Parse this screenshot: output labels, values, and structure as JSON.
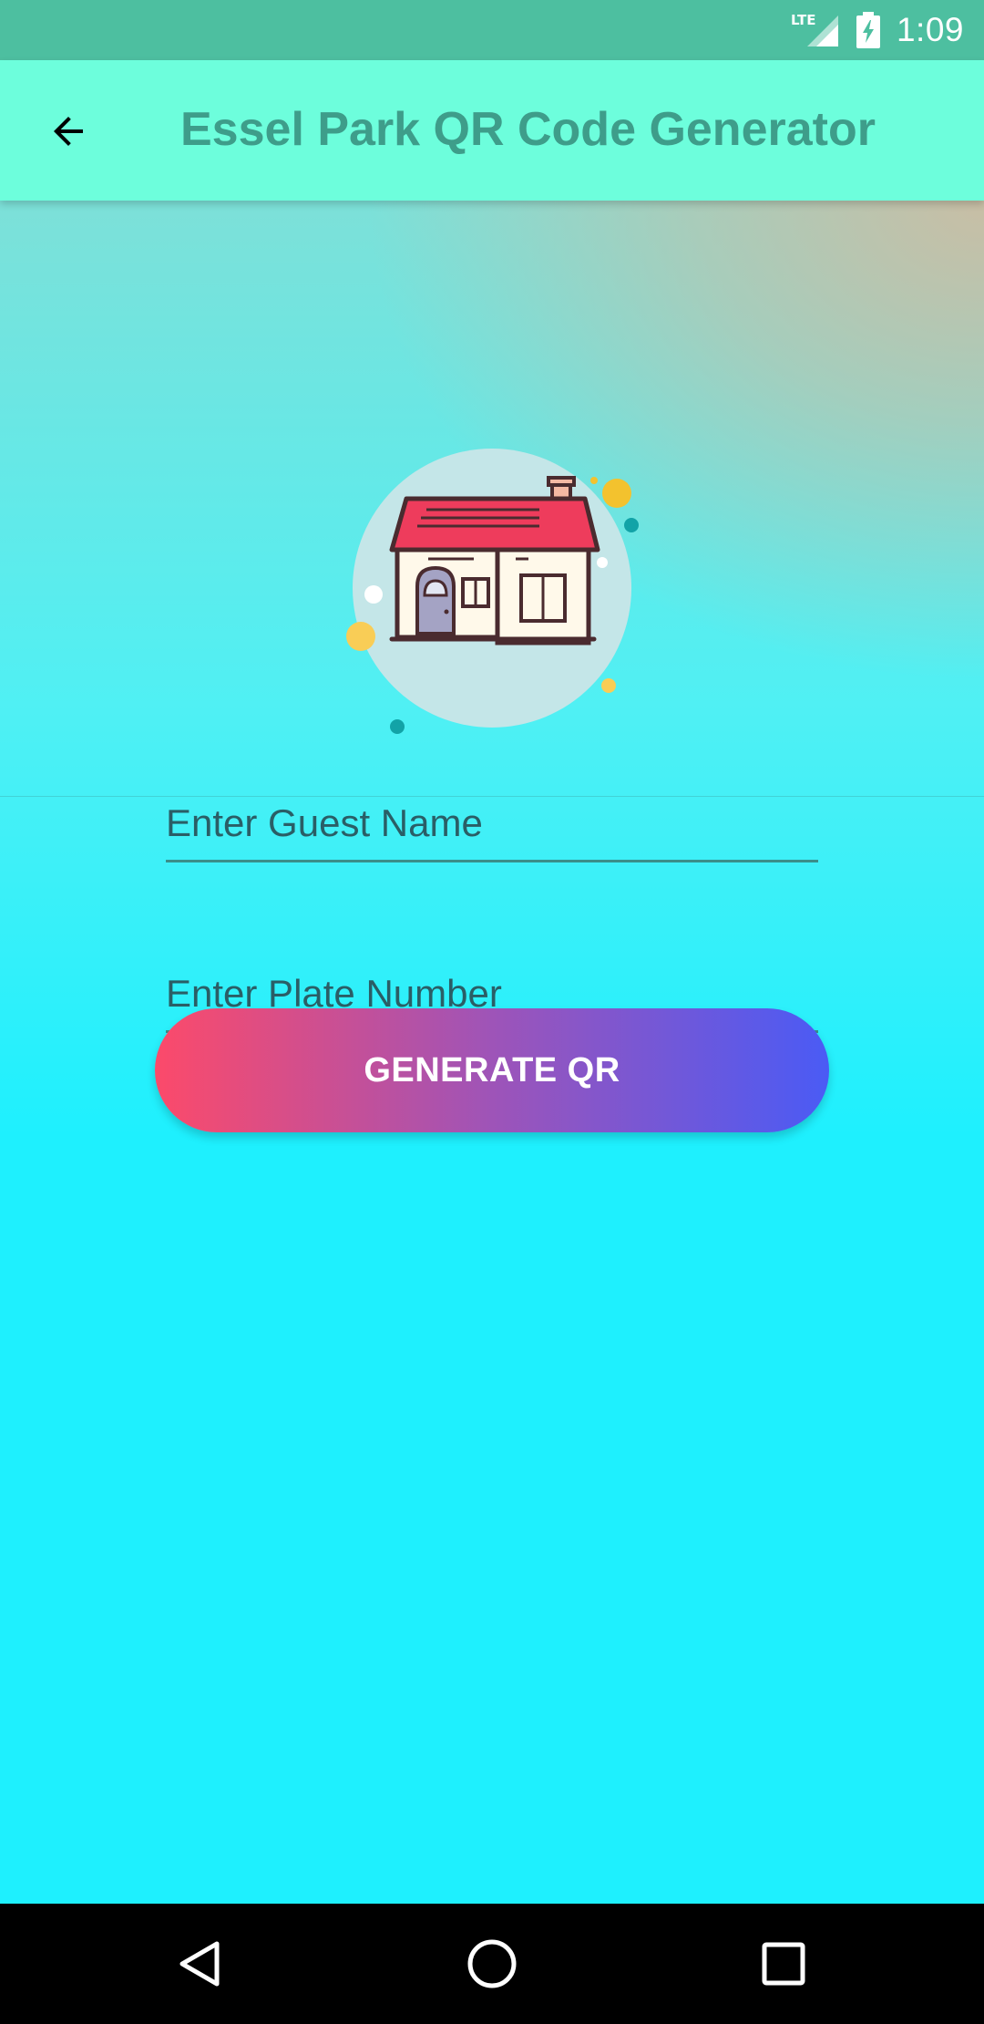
{
  "status_bar": {
    "network": "LTE",
    "time": "1:09"
  },
  "app_bar": {
    "title": "Essel Park QR Code Generator",
    "back_icon": "arrow-back-icon"
  },
  "header": {
    "illustration": "house-icon"
  },
  "form": {
    "guest_name": {
      "placeholder": "Enter Guest Name",
      "value": ""
    },
    "plate_number": {
      "placeholder": "Enter Plate Number",
      "value": ""
    },
    "generate_label": "GENERATE QR"
  },
  "colors": {
    "status_bar": "#4dbfa0",
    "app_bar": "#6dfedc",
    "title": "#3e9d8a",
    "background": "#1ef0fe",
    "button_start": "#fc4a6a",
    "button_end": "#4a5bf5"
  },
  "nav": {
    "back": "triangle-back-icon",
    "home": "circle-home-icon",
    "recents": "square-recents-icon"
  }
}
